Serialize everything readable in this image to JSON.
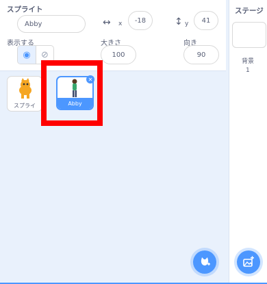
{
  "sprite_info": {
    "sprite_label": "スプライト",
    "sprite_name": "Abby",
    "x_label": "x",
    "x_value": "-18",
    "y_label": "y",
    "y_value": "41",
    "show_label": "表示する",
    "size_label": "大きさ",
    "size_value": "100",
    "direction_label": "向き",
    "direction_value": "90"
  },
  "sprites": [
    {
      "name": "スプライ"
    },
    {
      "name": "Abby"
    }
  ],
  "stage": {
    "title": "ステージ",
    "backdrops_label": "背景",
    "backdrops_count": "1"
  },
  "icons": {
    "x_arrow": "horizontal-arrow-icon",
    "y_arrow": "vertical-arrow-icon",
    "show": "eye-icon",
    "hide": "eye-slash-icon",
    "delete": "close-icon",
    "add_sprite": "cat-add-icon",
    "add_backdrop": "image-add-icon"
  },
  "colors": {
    "accent": "#4c97ff",
    "highlight": "#ff0000",
    "text": "#575e75"
  }
}
